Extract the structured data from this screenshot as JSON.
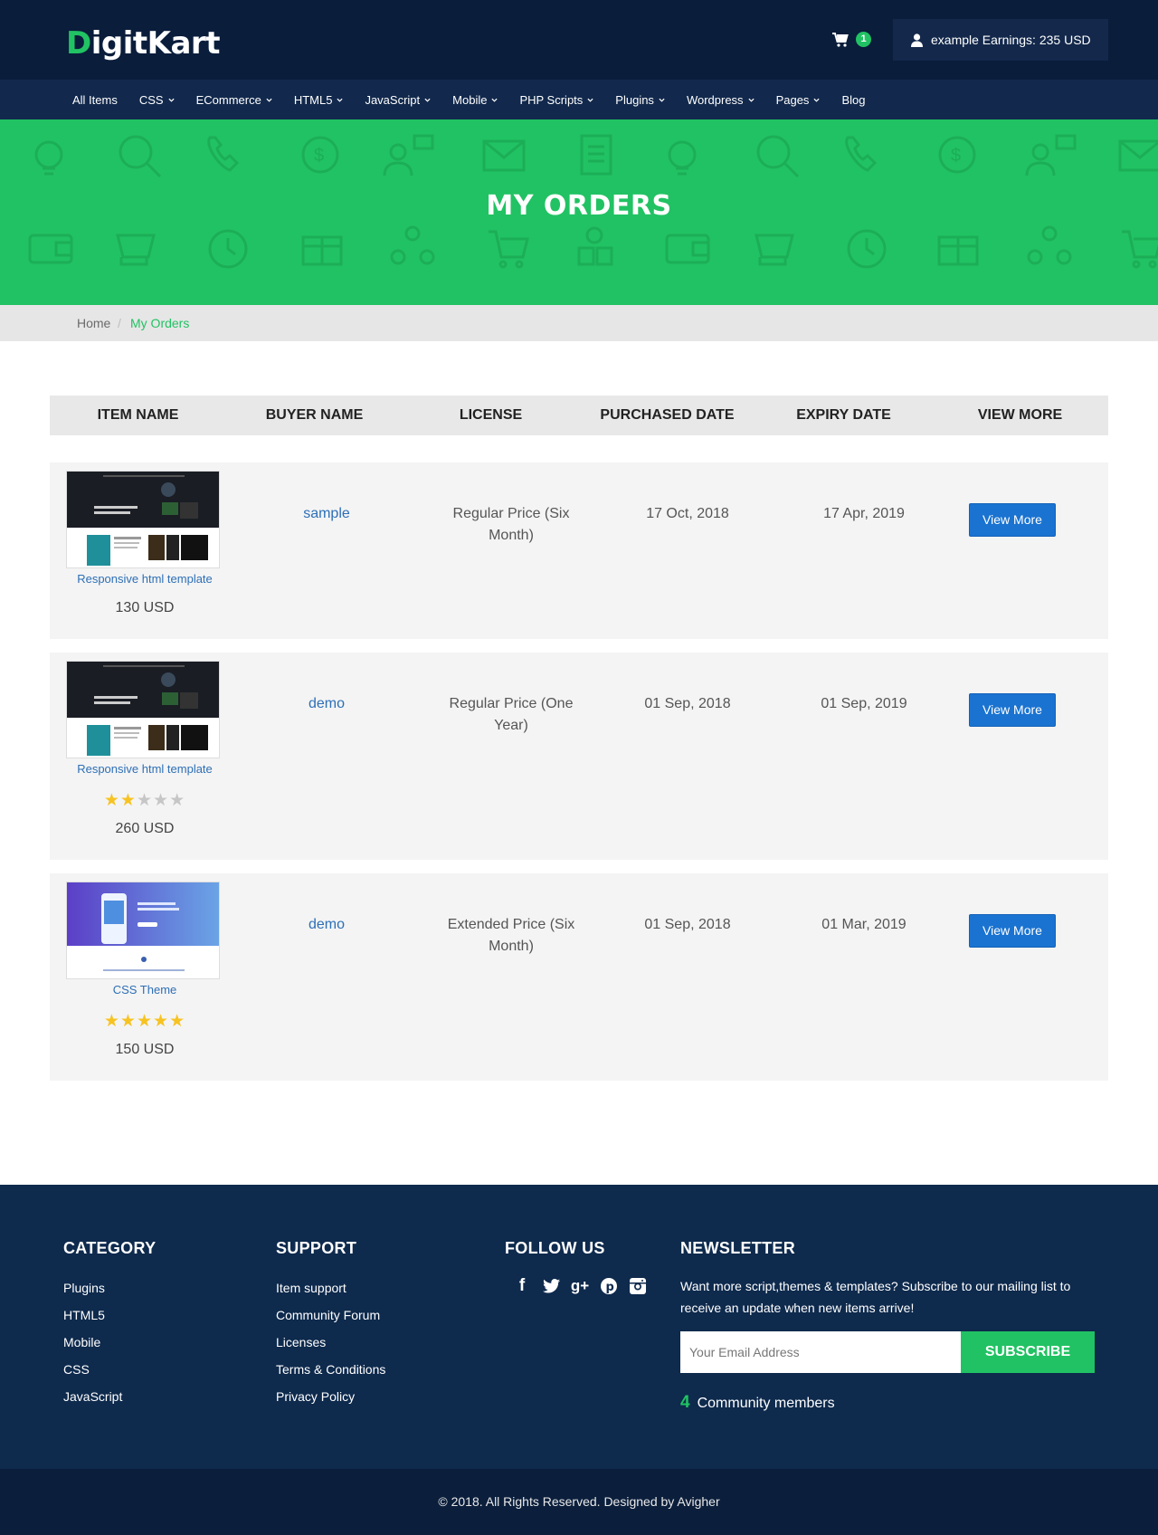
{
  "brand": {
    "logo_first": "D",
    "logo_rest": "igitKart"
  },
  "header": {
    "cart_count": "1",
    "earnings_label": "example Earnings: 235 USD"
  },
  "nav": {
    "items": [
      {
        "label": "All Items",
        "dropdown": false
      },
      {
        "label": "CSS",
        "dropdown": true
      },
      {
        "label": "ECommerce",
        "dropdown": true
      },
      {
        "label": "HTML5",
        "dropdown": true
      },
      {
        "label": "JavaScript",
        "dropdown": true
      },
      {
        "label": "Mobile",
        "dropdown": true
      },
      {
        "label": "PHP Scripts",
        "dropdown": true
      },
      {
        "label": "Plugins",
        "dropdown": true
      },
      {
        "label": "Wordpress",
        "dropdown": true
      },
      {
        "label": "Pages",
        "dropdown": true
      },
      {
        "label": "Blog",
        "dropdown": false
      }
    ]
  },
  "hero": {
    "title": "MY ORDERS"
  },
  "breadcrumb": {
    "home": "Home",
    "separator": "/",
    "current": "My Orders"
  },
  "table": {
    "headers": [
      "ITEM NAME",
      "BUYER NAME",
      "LICENSE",
      "PURCHASED DATE",
      "EXPIRY DATE",
      "VIEW MORE"
    ],
    "rows": [
      {
        "title": "Responsive html template",
        "rating": null,
        "price": "130 USD",
        "buyer": "sample",
        "license_line1": "Regular Price (Six",
        "license_line2": "Month)",
        "purchased": "17 Oct, 2018",
        "expiry": "17 Apr, 2019",
        "button": "View More"
      },
      {
        "title": "Responsive html template",
        "rating": 2,
        "price": "260 USD",
        "buyer": "demo",
        "license_line1": "Regular Price (One",
        "license_line2": "Year)",
        "purchased": "01 Sep, 2018",
        "expiry": "01 Sep, 2019",
        "button": "View More"
      },
      {
        "title": "CSS Theme",
        "rating": 5,
        "price": "150 USD",
        "buyer": "demo",
        "license_line1": "Extended Price (Six",
        "license_line2": "Month)",
        "purchased": "01 Sep, 2018",
        "expiry": "01 Mar, 2019",
        "button": "View More"
      }
    ]
  },
  "footer": {
    "category": {
      "title": "CATEGORY",
      "links": [
        "Plugins",
        "HTML5",
        "Mobile",
        "CSS",
        "JavaScript"
      ]
    },
    "support": {
      "title": "SUPPORT",
      "links": [
        "Item support",
        "Community Forum",
        "Licenses",
        "Terms & Conditions",
        "Privacy Policy"
      ]
    },
    "follow": {
      "title": "FOLLOW US",
      "icons": [
        "facebook-icon",
        "twitter-icon",
        "google-plus-icon",
        "pinterest-icon",
        "instagram-icon"
      ]
    },
    "newsletter": {
      "title": "NEWSLETTER",
      "text": "Want more script,themes & templates? Subscribe to our mailing list to receive an update when new items arrive!",
      "placeholder": "Your Email Address",
      "button": "SUBSCRIBE",
      "community_count": "4",
      "community_label": "Community members"
    },
    "copyright": "© 2018. All Rights Reserved. Designed by Avigher"
  },
  "colors": {
    "navy": "#0a1d3b",
    "green": "#21c263",
    "link_blue": "#2d6fb6",
    "button_blue": "#1a73d0"
  }
}
